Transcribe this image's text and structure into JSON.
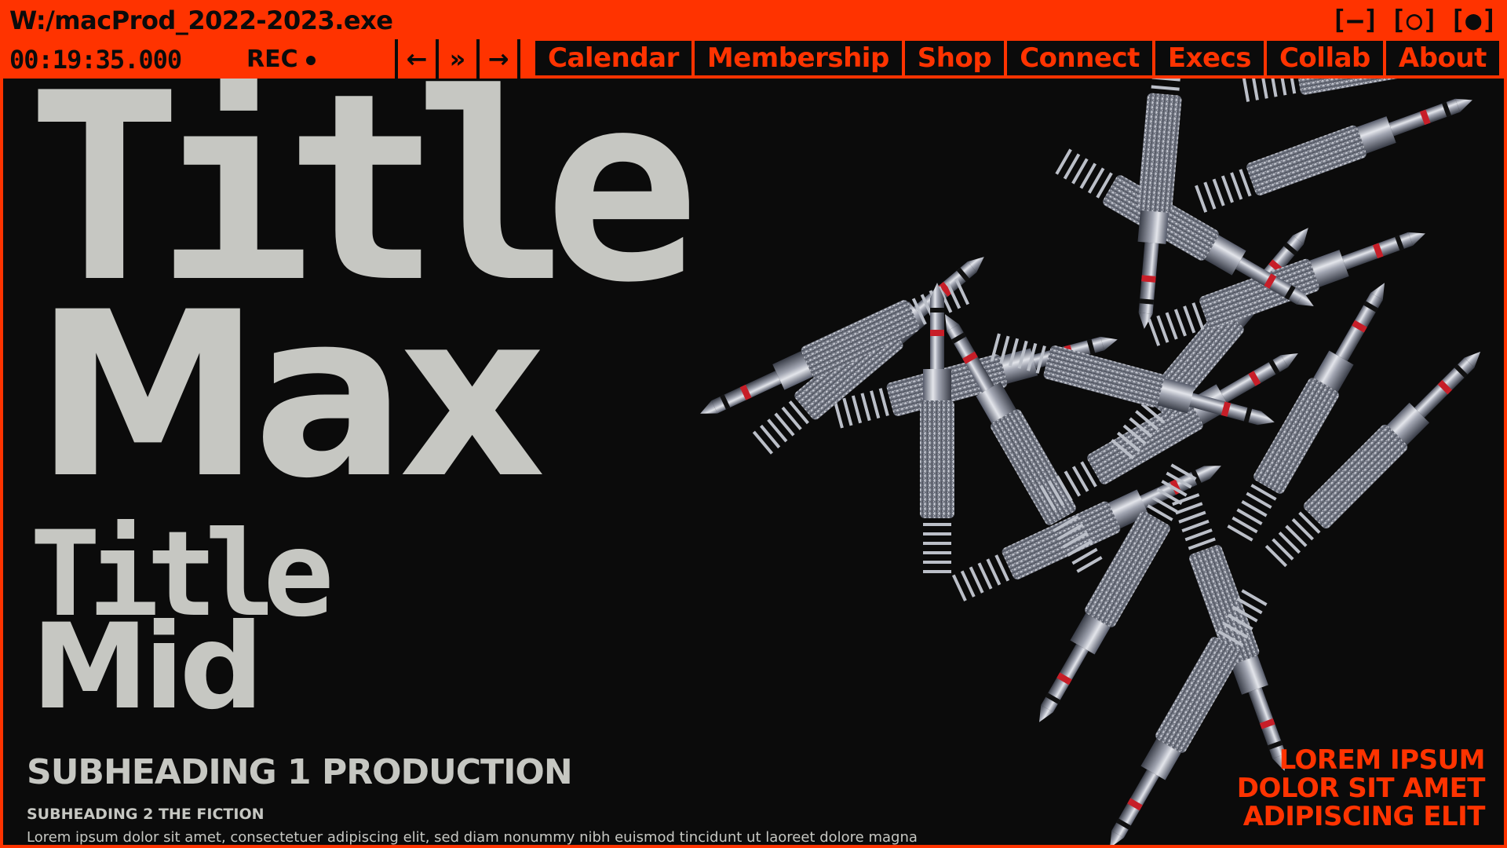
{
  "window": {
    "title": "W:/macProd_2022-2023.exe",
    "controls": {
      "minimize": "[–]",
      "maximize": "[○]",
      "close": "[●]"
    }
  },
  "toolbar": {
    "timecode": "00:19:35.000",
    "rec_label": "REC",
    "nav": {
      "back": "←",
      "skip": "»",
      "forward": "→"
    }
  },
  "menu": {
    "items": [
      "Calendar",
      "Membership",
      "Shop",
      "Connect",
      "Execs",
      "Collab",
      "About"
    ]
  },
  "hero": {
    "title_max_line1": "Title",
    "title_max_line2": "Max",
    "title_mid_line1": "Title",
    "title_mid_line2": "Mid",
    "subheading1": "SUBHEADING 1 PRODUCTION",
    "subheading2": "SUBHEADING 2 THE FICTION",
    "body": "Lorem ipsum dolor sit amet, consectetuer adipiscing elit, sed diam nonummy nibh euismod tincidunt ut laoreet dolore magna"
  },
  "side_text": {
    "line1": "LOREM IPSUM",
    "line2": "DOLOR SIT AMET",
    "line3": "ADIPISCING ELIT"
  },
  "colors": {
    "accent": "#ff3300",
    "background": "#0b0b0b",
    "text": "#c6c7c2"
  },
  "art": {
    "subject": "audio-jack-plugs-3d-render"
  }
}
